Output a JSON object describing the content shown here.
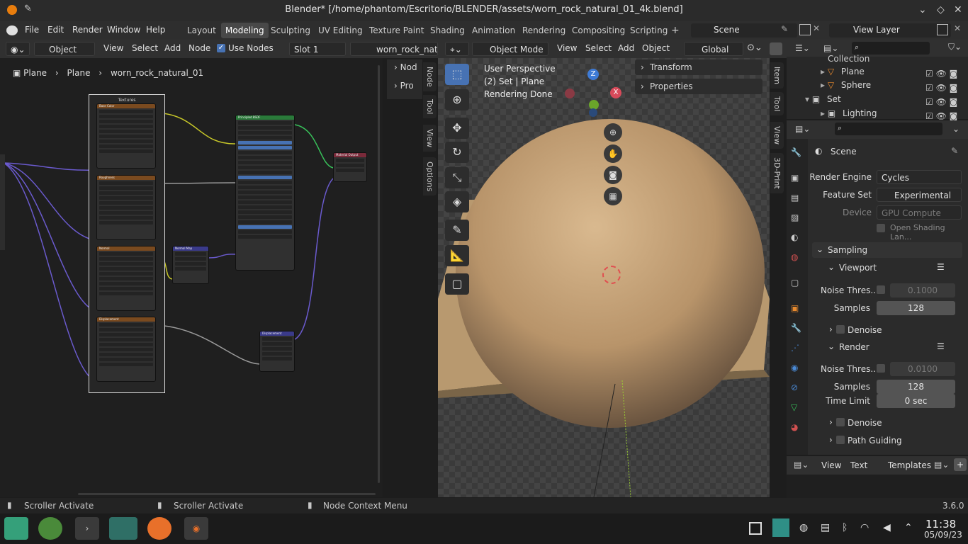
{
  "title": "Blender* [/home/phantom/Escritorio/BLENDER/assets/worn_rock_natural_01_4k.blend]",
  "menu": {
    "file": "File",
    "edit": "Edit",
    "render": "Render",
    "window": "Window",
    "help": "Help"
  },
  "workspaces": [
    "Layout",
    "Modeling",
    "Sculpting",
    "UV Editing",
    "Texture Paint",
    "Shading",
    "Animation",
    "Rendering",
    "Compositing",
    "Scripting"
  ],
  "scene": "Scene",
  "view_layer": "View Layer",
  "node_header": {
    "object": "Object",
    "view": "View",
    "select": "Select",
    "add": "Add",
    "node": "Node",
    "use_nodes": "Use Nodes",
    "slot": "Slot 1",
    "material": "worn_rock_natur"
  },
  "breadcrumb": {
    "a": "Plane",
    "b": "Plane",
    "c": "worn_rock_natural_01"
  },
  "nodes": {
    "textures_frame": "Textures",
    "base_color": "Base Color",
    "roughness": "Roughness",
    "normal": "Normal",
    "displacement": "Displacement",
    "principled": "Principled BSDF",
    "material_output": "Material Output",
    "normal_map": "Normal Map",
    "displacement_node": "Displacement"
  },
  "side_tabs_ne": [
    "Node",
    "Tool",
    "View",
    "Options"
  ],
  "ne_n_panel": {
    "node": "Nod",
    "pro": "Pro"
  },
  "viewport_header": {
    "mode": "Object Mode",
    "view": "View",
    "select": "Select",
    "add": "Add",
    "object": "Object",
    "orientation": "Global"
  },
  "viewport_info": {
    "line1": "User Perspective",
    "line2": "(2) Set | Plane",
    "line3": "Rendering Done"
  },
  "vp_panels": {
    "transform": "Transform",
    "properties": "Properties"
  },
  "side_tabs_vp": [
    "Item",
    "Tool",
    "View",
    "3D-Print"
  ],
  "axes": {
    "z": "Z",
    "x": "X"
  },
  "outliner": {
    "collection": "Collection",
    "items": [
      {
        "name": "Plane"
      },
      {
        "name": "Sphere"
      },
      {
        "name": "Set"
      },
      {
        "name": "Lighting"
      }
    ]
  },
  "properties": {
    "scene": "Scene",
    "render_engine_label": "Render Engine",
    "render_engine": "Cycles",
    "feature_set_label": "Feature Set",
    "feature_set": "Experimental",
    "device_label": "Device",
    "device": "GPU Compute",
    "open_shading": "Open Shading Lan...",
    "sampling": "Sampling",
    "viewport": "Viewport",
    "noise_label": "Noise Thres...",
    "vp_noise": "0.1000",
    "samples_label": "Samples",
    "vp_samples": "128",
    "denoise": "Denoise",
    "render": "Render",
    "r_noise": "0.0100",
    "r_samples": "128",
    "time_limit_label": "Time Limit",
    "time_limit": "0 sec",
    "path_guiding": "Path Guiding"
  },
  "text_editor": {
    "view": "View",
    "text": "Text",
    "templates": "Templates"
  },
  "status": {
    "s1": "Scroller Activate",
    "s2": "Scroller Activate",
    "s3": "Node Context Menu",
    "version": "3.6.0"
  },
  "clock": {
    "time": "11:38",
    "date": "05/09/23"
  },
  "colors": {
    "accent": "#4772b3",
    "active_tab": "#484848",
    "panel_bg": "#2b2b2b"
  }
}
